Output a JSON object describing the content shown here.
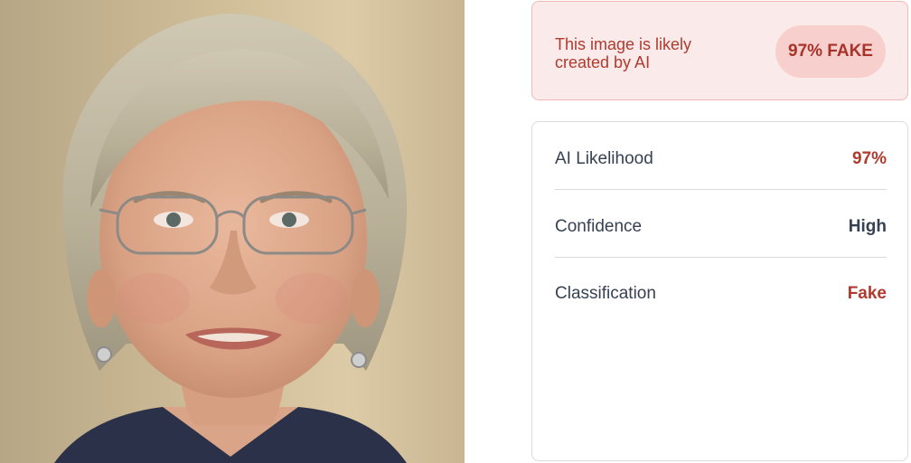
{
  "image_panel": {
    "subject": "photo of an older woman with short gray hair, glasses and earrings"
  },
  "verdict": {
    "message": "This image is likely created by AI",
    "badge": "97% FAKE",
    "colors": {
      "background": "#fbeaea",
      "border": "#f0b9b5",
      "text": "#b03a2e",
      "badge_background": "#f7cfcc"
    }
  },
  "metrics": [
    {
      "label": "AI Likelihood",
      "value": "97%",
      "value_color": "#b03a2e"
    },
    {
      "label": "Confidence",
      "value": "High",
      "value_color": "#364152"
    },
    {
      "label": "Classification",
      "value": "Fake",
      "value_color": "#b03a2e"
    }
  ]
}
